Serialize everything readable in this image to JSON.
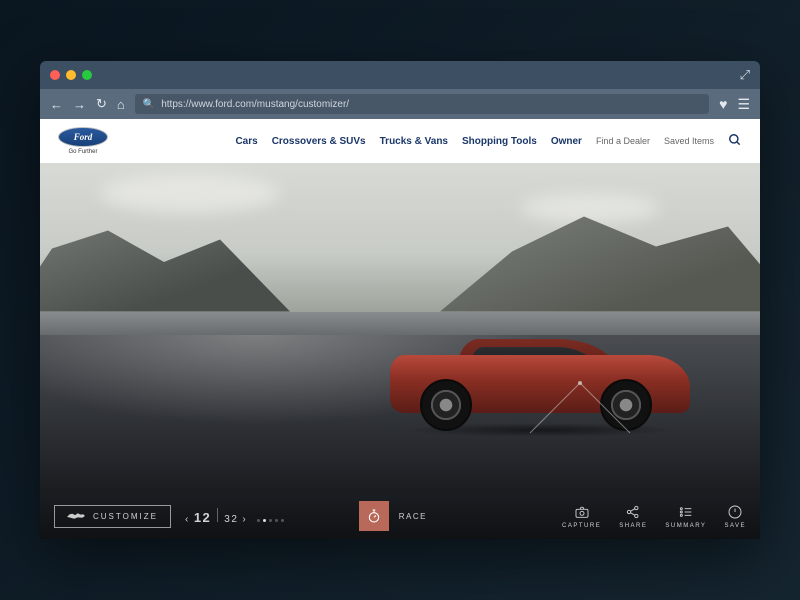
{
  "browser": {
    "url": "https://www.ford.com/mustang/customizer/"
  },
  "brand": {
    "name": "Ford",
    "tagline": "Go Further"
  },
  "nav": {
    "items": [
      "Cars",
      "Crossovers & SUVs",
      "Trucks & Vans",
      "Shopping Tools",
      "Owner"
    ],
    "utils": [
      "Find a Dealer",
      "Saved Items"
    ]
  },
  "footer": {
    "customize": "CUSTOMIZE",
    "counter": {
      "current": "12",
      "total": "32"
    },
    "race": "RACE",
    "actions": [
      {
        "label": "CAPTURE",
        "icon": "camera-icon"
      },
      {
        "label": "SHARE",
        "icon": "share-icon"
      },
      {
        "label": "SUMMARY",
        "icon": "list-icon"
      },
      {
        "label": "SAVE",
        "icon": "power-icon"
      }
    ]
  }
}
